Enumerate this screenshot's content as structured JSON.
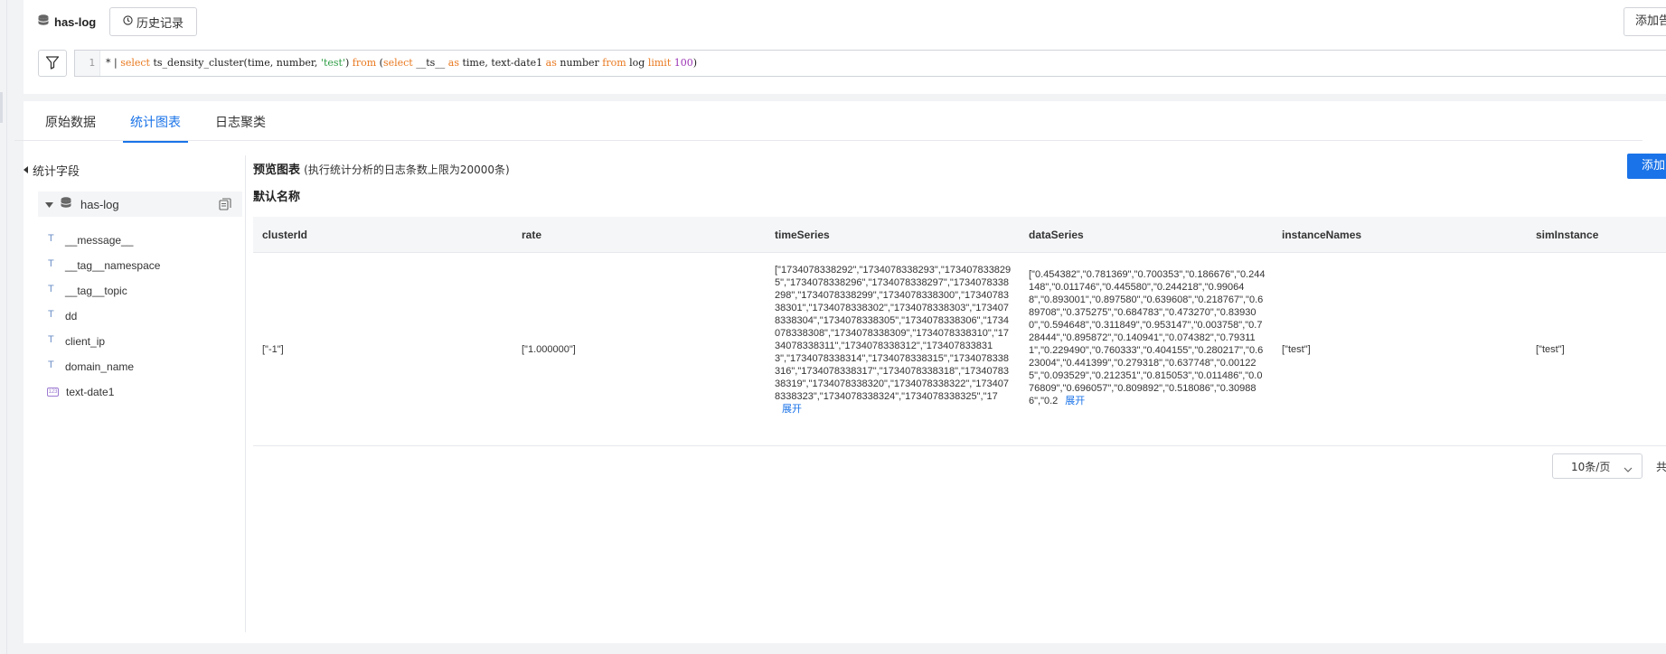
{
  "header": {
    "logstore_name": "has-log",
    "history_label": "历史记录",
    "add_label": "添加告警"
  },
  "query": {
    "line_number": "1",
    "parts": [
      {
        "t": "* | ",
        "c": ""
      },
      {
        "t": "select",
        "c": "kw"
      },
      {
        "t": " ts_density_cluster(time, number, ",
        "c": ""
      },
      {
        "t": "'test'",
        "c": "str"
      },
      {
        "t": ") ",
        "c": ""
      },
      {
        "t": "from",
        "c": "kw"
      },
      {
        "t": " (",
        "c": ""
      },
      {
        "t": "select",
        "c": "kw"
      },
      {
        "t": " __ts__ ",
        "c": ""
      },
      {
        "t": "as",
        "c": "kw"
      },
      {
        "t": " time, text-date1 ",
        "c": ""
      },
      {
        "t": "as",
        "c": "kw"
      },
      {
        "t": " number ",
        "c": ""
      },
      {
        "t": "from",
        "c": "kw"
      },
      {
        "t": " log ",
        "c": ""
      },
      {
        "t": "limit",
        "c": "kw"
      },
      {
        "t": " ",
        "c": ""
      },
      {
        "t": "100",
        "c": "num"
      },
      {
        "t": ")",
        "c": ""
      }
    ]
  },
  "tabs": [
    {
      "label": "原始数据",
      "active": false
    },
    {
      "label": "统计图表",
      "active": true
    },
    {
      "label": "日志聚类",
      "active": false
    }
  ],
  "sidebar": {
    "back_label": "统计字段",
    "logstore": "has-log",
    "fields": [
      {
        "name": "__message__",
        "type": "text"
      },
      {
        "name": "__tag__namespace",
        "type": "text"
      },
      {
        "name": "__tag__topic",
        "type": "text"
      },
      {
        "name": "dd",
        "type": "text"
      },
      {
        "name": "client_ip",
        "type": "text"
      },
      {
        "name": "domain_name",
        "type": "text"
      },
      {
        "name": "text-date1",
        "type": "number"
      }
    ],
    "number_icon_text": "123"
  },
  "preview": {
    "title": "预览图表",
    "note": "(执行统计分析的日志条数上限为20000条)",
    "default_name": "默认名称",
    "add_label": "添加到仪表盘"
  },
  "table": {
    "columns": [
      "clusterId",
      "rate",
      "timeSeries",
      "dataSeries",
      "instanceNames",
      "simInstance"
    ],
    "rows": [
      {
        "clusterId": "[\"-1\"]",
        "rate": "[\"1.000000\"]",
        "timeSeries": "[\"1734078338292\",\"1734078338293\",\"1734078338295\",\"1734078338296\",\"1734078338297\",\"1734078338298\",\"1734078338299\",\"1734078338300\",\"1734078338301\",\"1734078338302\",\"1734078338303\",\"1734078338304\",\"1734078338305\",\"1734078338306\",\"1734078338308\",\"1734078338309\",\"1734078338310\",\"1734078338311\",\"1734078338312\",\"1734078338313\",\"1734078338314\",\"1734078338315\",\"1734078338316\",\"1734078338317\",\"1734078338318\",\"1734078338319\",\"1734078338320\",\"1734078338322\",\"1734078338323\",\"1734078338324\",\"1734078338325\",\"17",
        "dataSeries": "[\"0.454382\",\"0.781369\",\"0.700353\",\"0.186676\",\"0.244148\",\"0.011746\",\"0.445580\",\"0.244218\",\"0.990648\",\"0.893001\",\"0.897580\",\"0.639608\",\"0.218767\",\"0.689708\",\"0.375275\",\"0.684783\",\"0.473270\",\"0.839300\",\"0.594648\",\"0.311849\",\"0.953147\",\"0.003758\",\"0.728444\",\"0.895872\",\"0.140941\",\"0.074382\",\"0.793111\",\"0.229490\",\"0.760333\",\"0.404155\",\"0.280217\",\"0.623004\",\"0.441399\",\"0.279318\",\"0.637748\",\"0.001225\",\"0.093529\",\"0.212351\",\"0.815053\",\"0.011486\",\"0.076809\",\"0.696057\",\"0.809892\",\"0.518086\",\"0.309886\",\"0.2",
        "instanceNames": "[\"test\"]",
        "simInstance": "[\"test\"]",
        "expand_label": "展开"
      }
    ]
  },
  "pagination": {
    "page_size_label": "10条/页",
    "total_label": "共"
  }
}
